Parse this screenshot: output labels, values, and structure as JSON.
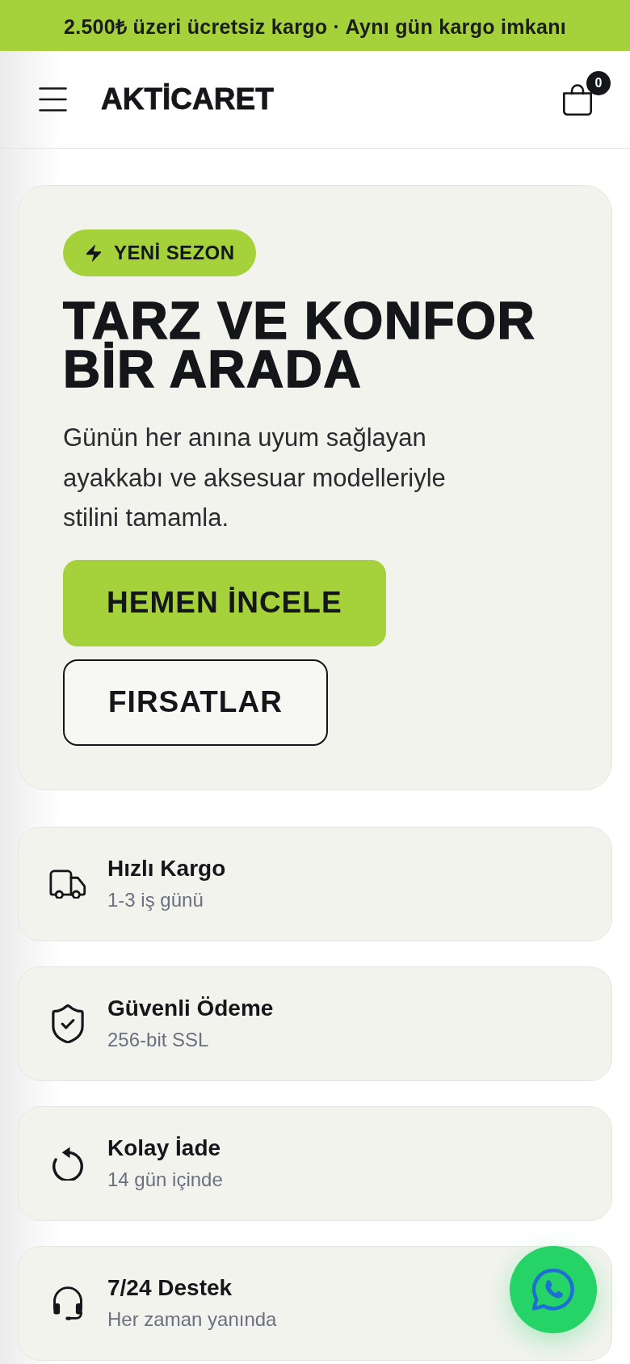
{
  "announcement_bar": {
    "text": "2.500₺ üzeri ücretsiz kargo · Aynı gün kargo imkanı"
  },
  "header": {
    "logo": "AKTİCARET",
    "cart_count": "0"
  },
  "hero": {
    "badge": "YENİ SEZON",
    "title": "TARZ VE KONFOR BİR ARADA",
    "description": "Günün her anına uyum sağlayan ayakkabı ve aksesuar modelleriyle stilini tamamla.",
    "buttons": [
      {
        "label": "HEMEN İNCELE",
        "kind": "primary"
      },
      {
        "label": "FIRSATLAR",
        "kind": "outline"
      }
    ]
  },
  "features": [
    {
      "title": "Hızlı Kargo",
      "subtitle": "1-3 iş günü"
    },
    {
      "title": "Güvenli Ödeme",
      "subtitle": "256-bit SSL"
    },
    {
      "title": "Kolay İade",
      "subtitle": "14 gün içinde"
    },
    {
      "title": "7/24 Destek",
      "subtitle": "Her zaman yanında"
    }
  ]
}
